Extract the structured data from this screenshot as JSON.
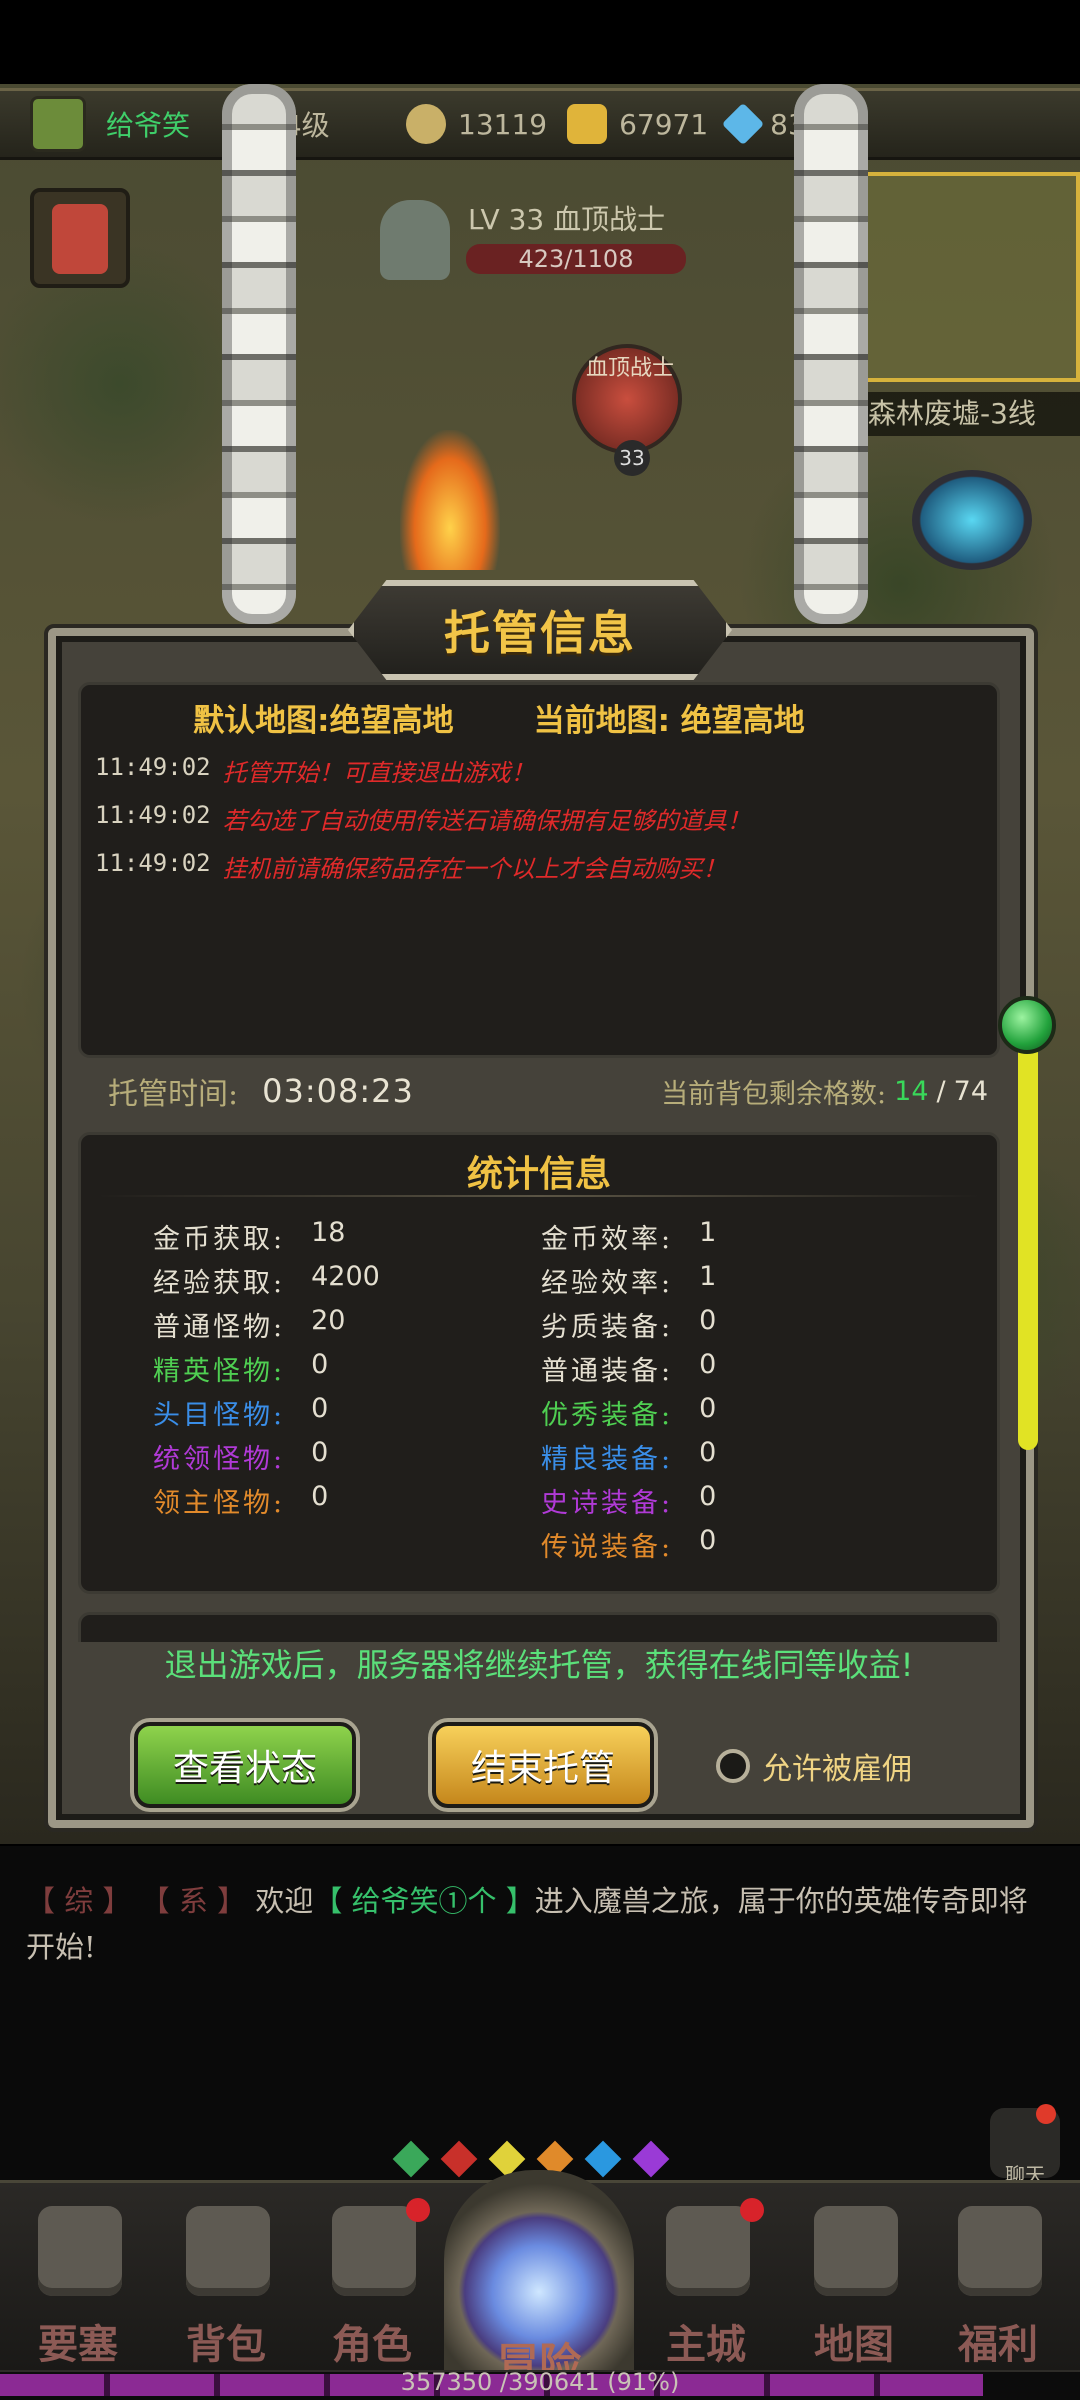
{
  "topbar": {
    "player_name": "给爷笑",
    "level": "34级",
    "power": "13119",
    "gold": "67971",
    "diamonds": "835"
  },
  "scene": {
    "boss_label": "LV 33 血顶战士",
    "boss_hp": "423/1108",
    "mob_name": "血顶战士",
    "mob_level": "33",
    "side_map_name": "森林废墟-3线"
  },
  "dialog": {
    "title": "托管信息",
    "default_map": "默认地图:绝望高地",
    "current_map": "当前地图: 绝望高地",
    "log": [
      {
        "time": "11:49:02",
        "msg": "托管开始！可直接退出游戏！"
      },
      {
        "time": "11:49:02",
        "msg": "若勾选了自动使用传送石请确保拥有足够的道具！"
      },
      {
        "time": "11:49:02",
        "msg": "挂机前请确保药品存在一个以上才会自动购买！"
      }
    ],
    "hosting_time_label": "托管时间:",
    "hosting_time": "03:08:23",
    "bag_label": "当前背包剩余格数:",
    "bag_free": "14",
    "bag_sep": "/",
    "bag_total": "74",
    "stats_title": "统计信息",
    "stats_left": [
      {
        "label": "金币获取:",
        "value": "18",
        "color": "#e4dfd0"
      },
      {
        "label": "经验获取:",
        "value": "4200",
        "color": "#e4dfd0"
      },
      {
        "label": "普通怪物:",
        "value": "20",
        "color": "#e4dfd0"
      },
      {
        "label": "精英怪物:",
        "value": "0",
        "color": "#4fcf52"
      },
      {
        "label": "头目怪物:",
        "value": "0",
        "color": "#3a8ee8"
      },
      {
        "label": "统领怪物:",
        "value": "0",
        "color": "#b03ad6"
      },
      {
        "label": "领主怪物:",
        "value": "0",
        "color": "#e28a2b"
      }
    ],
    "stats_right": [
      {
        "label": "金币效率:",
        "value": "1",
        "color": "#e4dfd0"
      },
      {
        "label": "经验效率:",
        "value": "1",
        "color": "#e4dfd0"
      },
      {
        "label": "劣质装备:",
        "value": "0",
        "color": "#e4dfd0"
      },
      {
        "label": "普通装备:",
        "value": "0",
        "color": "#e4dfd0"
      },
      {
        "label": "优秀装备:",
        "value": "0",
        "color": "#4fcf52"
      },
      {
        "label": "精良装备:",
        "value": "0",
        "color": "#3a8ee8"
      },
      {
        "label": "史诗装备:",
        "value": "0",
        "color": "#b03ad6"
      },
      {
        "label": "传说装备:",
        "value": "0",
        "color": "#e28a2b"
      }
    ],
    "notice": "退出游戏后，服务器将继续托管，获得在线同等收益!",
    "btn_status": "查看状态",
    "btn_end": "结束托管",
    "allow_hire": "允许被雇佣"
  },
  "chat": {
    "tag1": "【 综 】",
    "tag2": "【 系 】",
    "welcome": "欢迎",
    "player": "【 给爷笑①个 】",
    "message": "进入魔兽之旅，属于你的英雄传奇即将开始!",
    "button": "聊天"
  },
  "nav": {
    "items": [
      "要塞",
      "背包",
      "角色",
      "冒险",
      "主城",
      "地图",
      "福利"
    ],
    "gem_colors": [
      "#3aa85a",
      "#c8302a",
      "#e0d23a",
      "#e08a2a",
      "#2a98e0",
      "#9a3ad6"
    ]
  },
  "exp": {
    "text": "357350 /390641 (91%)",
    "fraction": 0.91
  }
}
